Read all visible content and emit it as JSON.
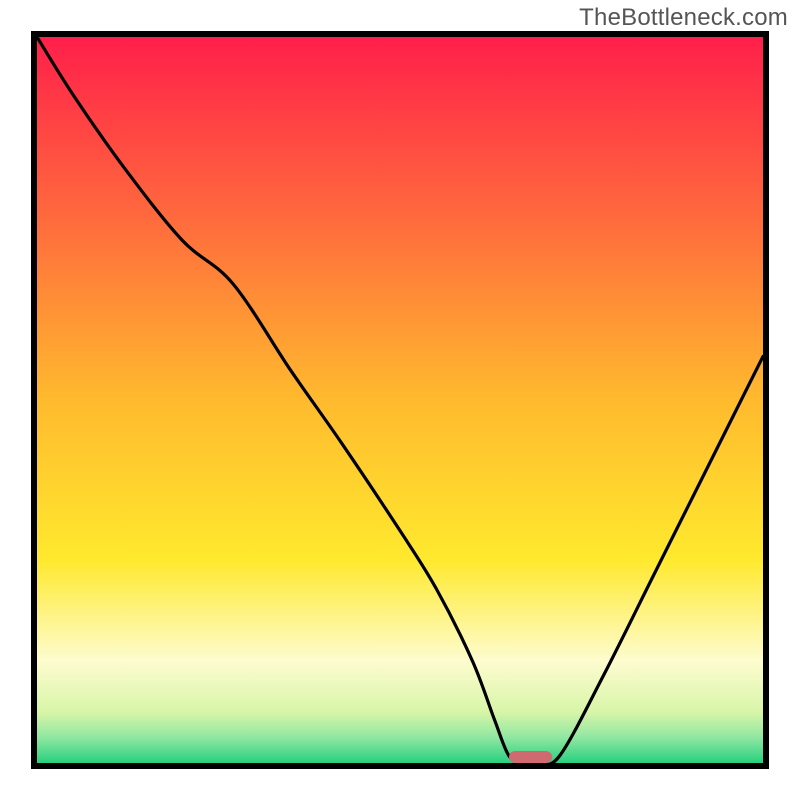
{
  "watermark": {
    "text": "TheBottleneck.com"
  },
  "colors": {
    "border": "#000000",
    "marker": "#cf6a71",
    "curve": "#000000",
    "gradient_stops": [
      {
        "offset": 0.0,
        "color": "#ff1f4a"
      },
      {
        "offset": 0.25,
        "color": "#ff6a3d"
      },
      {
        "offset": 0.5,
        "color": "#ffba2e"
      },
      {
        "offset": 0.72,
        "color": "#ffe92e"
      },
      {
        "offset": 0.86,
        "color": "#fdfccf"
      },
      {
        "offset": 0.93,
        "color": "#d8f5a8"
      },
      {
        "offset": 0.965,
        "color": "#8fe7a1"
      },
      {
        "offset": 1.0,
        "color": "#27d07f"
      }
    ]
  },
  "chart_data": {
    "type": "line",
    "title": "",
    "xlabel": "",
    "ylabel": "",
    "xlim": [
      0,
      100
    ],
    "ylim": [
      0,
      100
    ],
    "grid": false,
    "legend": false,
    "x": [
      0,
      5,
      12,
      20,
      27,
      35,
      42,
      50,
      55,
      60,
      63,
      65,
      67,
      69,
      72,
      78,
      85,
      92,
      100
    ],
    "y": [
      100,
      92,
      82,
      72,
      66,
      54,
      44,
      32,
      24,
      14,
      6,
      1,
      0,
      0,
      1,
      12,
      26,
      40,
      56
    ],
    "marker": {
      "x_center": 68,
      "y": 0,
      "width_pct": 6,
      "height_pct": 1.6
    }
  }
}
